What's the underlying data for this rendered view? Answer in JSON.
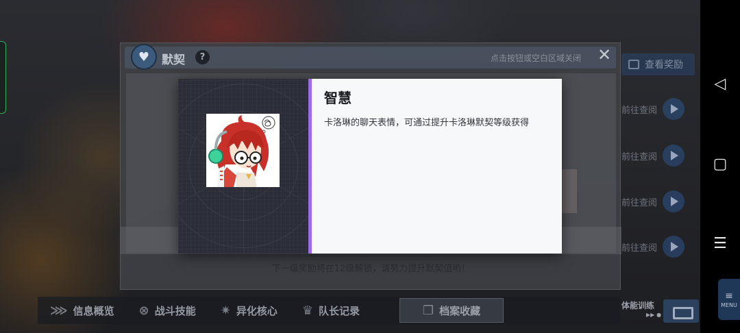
{
  "background_screen": {
    "view_rewards_label": "查看奖励",
    "goto_label": "前往查阅",
    "goto_rows": 4,
    "nav_tabs": [
      {
        "label": "信息概览",
        "icon": "overview-icon"
      },
      {
        "label": "战斗技能",
        "icon": "skill-icon"
      },
      {
        "label": "异化核心",
        "icon": "core-icon"
      },
      {
        "label": "队长记录",
        "icon": "crown-icon"
      },
      {
        "label": "档案收藏",
        "icon": "archive-icon",
        "active": true
      }
    ],
    "stamina_label": "体能训练",
    "stamina_sub": "▶▶ ●",
    "menu_label": "MENU"
  },
  "panel": {
    "title": "默契",
    "help_symbol": "?",
    "close_hint": "点击按钮或空白区域关闭",
    "close_symbol": "✕",
    "footer": "下一级奖励将在12级解锁，请努力提升默契值哟！"
  },
  "dialog": {
    "item_name": "智慧",
    "item_description": "卡洛琳的聊天表情，可通过提升卡洛琳默契等级获得",
    "accent_color": "#9b6ee8"
  },
  "android_nav": {
    "back": "◁",
    "home": "▢",
    "recents": "☰"
  }
}
